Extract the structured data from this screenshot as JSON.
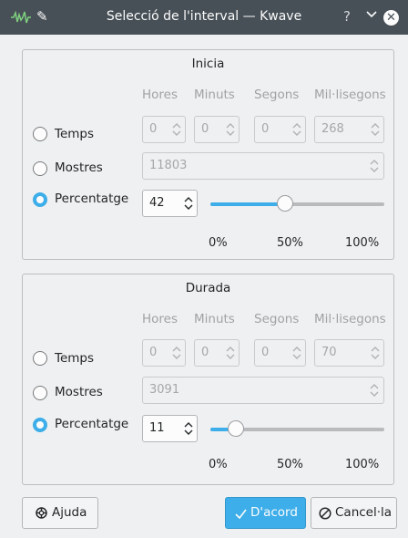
{
  "window": {
    "title": "Selecció de l'interval — Kwave",
    "help_glyph": "?",
    "close_glyph": "✕"
  },
  "columns": [
    "Hores",
    "Minuts",
    "Segons",
    "Mil·lisegons"
  ],
  "labels": {
    "time": "Temps",
    "samples": "Mostres",
    "percentage": "Percentatge"
  },
  "scale": [
    "0%",
    "50%",
    "100%"
  ],
  "start": {
    "title": "Inicia",
    "hours": "0",
    "minutes": "0",
    "seconds": "0",
    "milliseconds": "268",
    "samples": "11803",
    "percentage": "42",
    "slider_value": 0.42,
    "selected": "percentage"
  },
  "duration": {
    "title": "Durada",
    "hours": "0",
    "minutes": "0",
    "seconds": "0",
    "milliseconds": "70",
    "samples": "3091",
    "percentage": "11",
    "slider_value": 0.11,
    "selected": "percentage"
  },
  "buttons": {
    "help": "Ajuda",
    "ok": "D'acord",
    "cancel": "Cancel·la"
  },
  "colors": {
    "titlebar": "#475057",
    "accent": "#3daee9",
    "window": "#eff0f1"
  }
}
